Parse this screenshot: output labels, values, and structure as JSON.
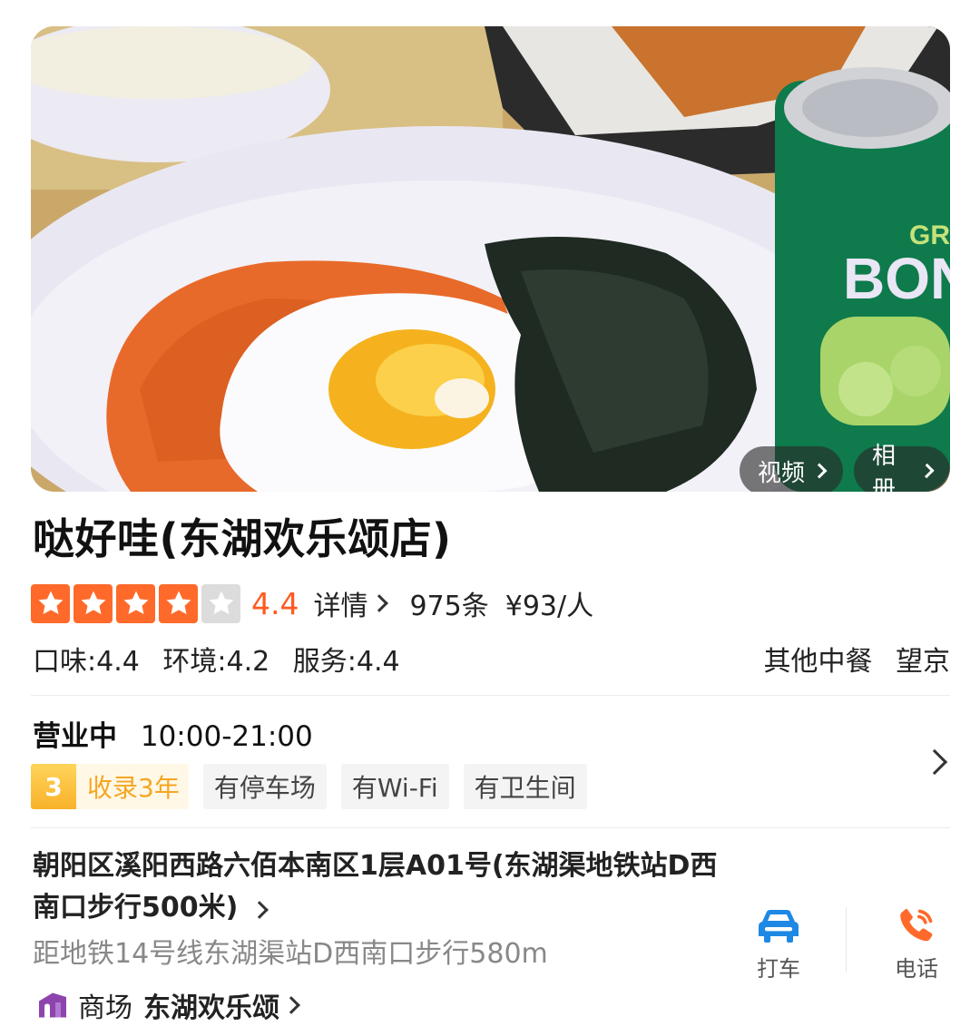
{
  "hero": {
    "video_label": "视频",
    "album_label": "相册",
    "can_text": "BON",
    "can_text_top": "GR"
  },
  "shop": {
    "name": "哒好哇(东湖欢乐颂店)",
    "score": "4.4",
    "stars_filled": 4,
    "stars_total": 5,
    "detail_label": "详情",
    "reviews": "975条",
    "price": "¥93/人",
    "taste": "口味:4.4",
    "environment": "环境:4.2",
    "service": "服务:4.4",
    "category": "其他中餐",
    "area": "望京"
  },
  "hours": {
    "status": "营业中",
    "time": "10:00-21:00"
  },
  "tags": {
    "years_badge": "3",
    "years_label": "收录3年",
    "items": [
      "有停车场",
      "有Wi-Fi",
      "有卫生间"
    ]
  },
  "address": {
    "line": "朝阳区溪阳西路六佰本南区1层A01号(东湖渠地铁站D西南口步行500米)",
    "metro": "距地铁14号线东湖渠站D西南口步行580m",
    "mall_label": "商场",
    "mall_name": "东湖欢乐颂"
  },
  "actions": {
    "taxi_label": "打车",
    "phone_label": "电话"
  },
  "colors": {
    "accent_orange": "#ff6a2b",
    "taxi_blue": "#1e88e5",
    "phone_orange": "#ff6a2b",
    "mall_purple": "#8e44ad"
  }
}
